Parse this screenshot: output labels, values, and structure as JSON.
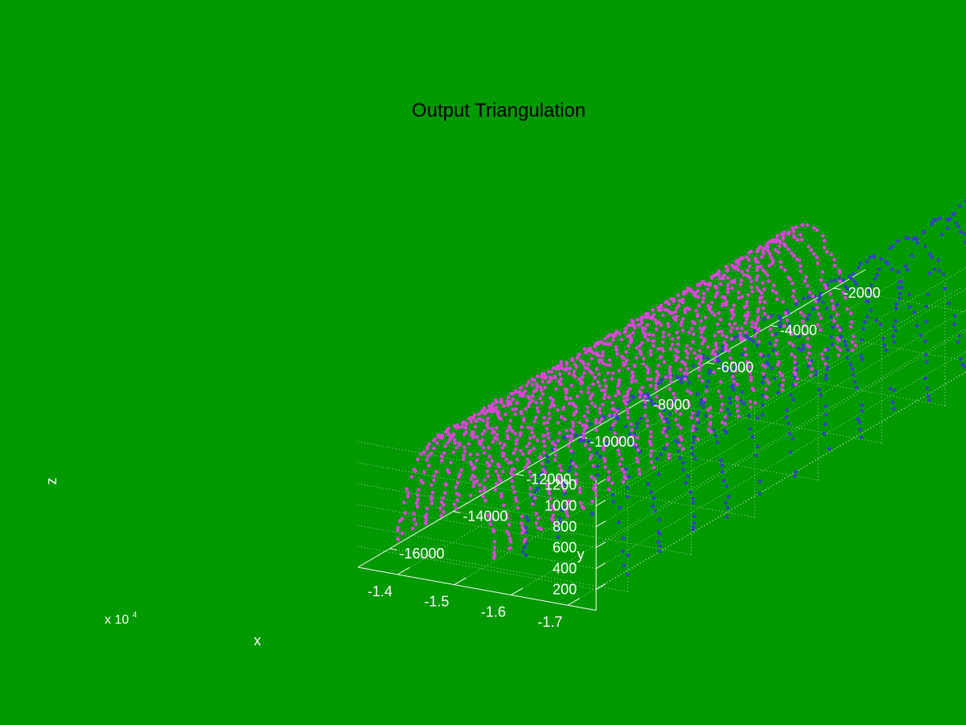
{
  "colors": {
    "background": "#009900",
    "text": "#ffffff",
    "title": "#000000",
    "series_blue": "#3b3bd6",
    "series_magenta": "#d946d9",
    "grid": "#cfe9cf"
  },
  "chart_data": {
    "type": "scatter",
    "projection": "3d",
    "title": "Output Triangulation",
    "xlabel": "x",
    "ylabel": "y",
    "zlabel": "z",
    "x_exponent_label": "x 10",
    "x_exponent_power": "4",
    "x_ticks": [
      -1.7,
      -1.6,
      -1.5,
      -1.4
    ],
    "x_tick_labels": [
      "-1.7",
      "-1.6",
      "-1.5",
      "-1.4"
    ],
    "y_ticks": [
      -16000,
      -14000,
      -12000,
      -10000,
      -8000,
      -6000,
      -4000,
      -2000
    ],
    "y_tick_labels": [
      "-16000",
      "-14000",
      "-12000",
      "-10000",
      "-8000",
      "-6000",
      "-4000",
      "-2000"
    ],
    "z_ticks": [
      200,
      400,
      600,
      800,
      1000,
      1200
    ],
    "z_tick_labels": [
      "200",
      "400",
      "600",
      "800",
      "1000",
      "1200"
    ],
    "xlim": [
      -17500,
      -13300
    ],
    "ylim": [
      -17000,
      -1000
    ],
    "zlim": [
      0,
      1300
    ],
    "grid": true,
    "series": [
      {
        "color": "#3b3bd6",
        "structure": "arches",
        "x_center": -16300,
        "x_half_width": 900,
        "y_range": [
          -15500,
          -2800
        ],
        "arch_count": 13,
        "height": 1250,
        "taper": 0.65
      },
      {
        "color": "#d946d9",
        "structure": "arches",
        "x_center": -14200,
        "x_half_width": 850,
        "y_range": [
          -15800,
          -4500
        ],
        "arch_count": 26,
        "height": 1100,
        "taper": 0.55
      }
    ]
  }
}
